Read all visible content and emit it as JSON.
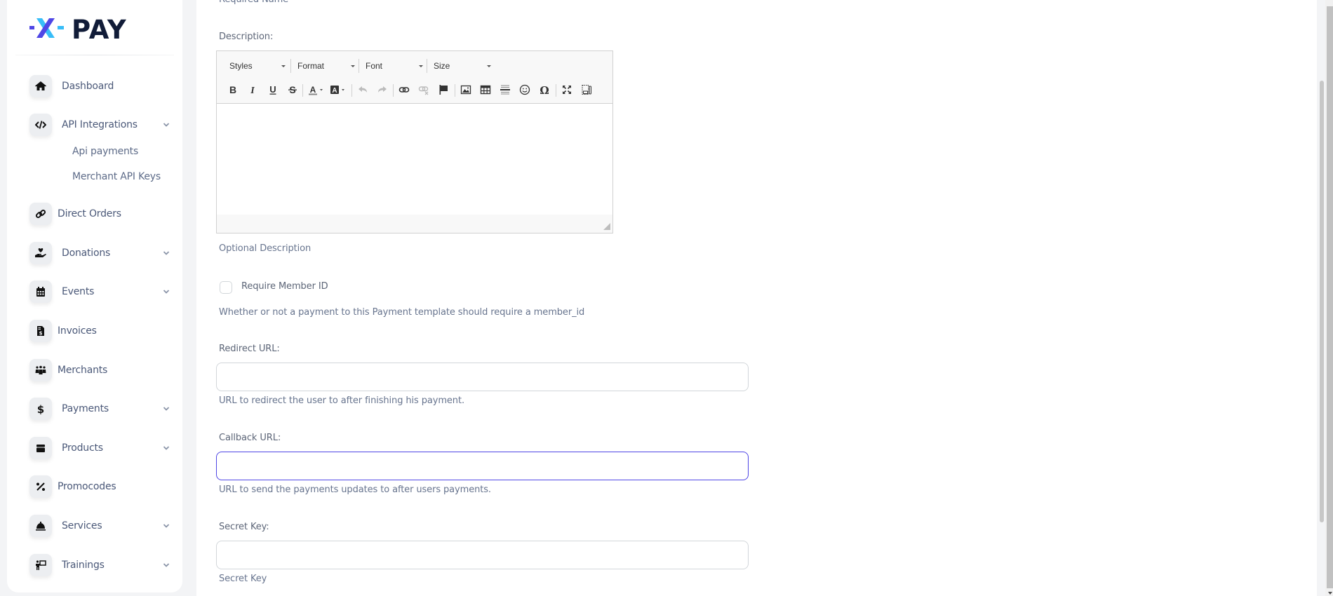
{
  "brand": {
    "logo_prefix": "X",
    "logo_text": "PAY",
    "colors": {
      "x_purple": "#4f46e5",
      "x_blue": "#38bdf8",
      "text_navy": "#111c38"
    }
  },
  "sidebar": {
    "items": [
      {
        "label": "Dashboard",
        "icon": "home-icon",
        "expandable": false
      },
      {
        "label": "API Integrations",
        "icon": "code-icon",
        "expandable": true,
        "expanded": true,
        "children": [
          {
            "label": "Api payments"
          },
          {
            "label": "Merchant API Keys"
          }
        ]
      },
      {
        "label": "Direct Orders",
        "icon": "link-icon",
        "expandable": false
      },
      {
        "label": "Donations",
        "icon": "hand-holding-heart-icon",
        "expandable": true
      },
      {
        "label": "Events",
        "icon": "calendar-icon",
        "expandable": true
      },
      {
        "label": "Invoices",
        "icon": "invoice-dollar-icon",
        "expandable": false
      },
      {
        "label": "Merchants",
        "icon": "people-group-icon",
        "expandable": false
      },
      {
        "label": "Payments",
        "icon": "dollar-sign-icon",
        "expandable": true
      },
      {
        "label": "Products",
        "icon": "box-icon",
        "expandable": true
      },
      {
        "label": "Promocodes",
        "icon": "percent-icon",
        "expandable": false
      },
      {
        "label": "Services",
        "icon": "concierge-bell-icon",
        "expandable": true
      },
      {
        "label": "Trainings",
        "icon": "chalkboard-teacher-icon",
        "expandable": true
      }
    ]
  },
  "form": {
    "name_hint": "Required Name",
    "description": {
      "label": "Description:",
      "hint": "Optional Description",
      "editor": {
        "combos": [
          "Styles",
          "Format",
          "Font",
          "Size"
        ],
        "content": ""
      }
    },
    "require_member_id": {
      "label": "Require Member ID",
      "checked": false,
      "hint": "Whether or not a payment to this Payment template should require a member_id"
    },
    "redirect_url": {
      "label": "Redirect URL:",
      "value": "",
      "hint": "URL to redirect the user to after finishing his payment."
    },
    "callback_url": {
      "label": "Callback URL:",
      "value": "",
      "hint": "URL to send the payments updates to after users payments.",
      "focused": true
    },
    "secret_key": {
      "label": "Secret Key:",
      "value": "",
      "hint": "Secret Key"
    }
  },
  "theme": {
    "focus_color": "#4f46e5",
    "page_bg": "#f3f4f6"
  }
}
